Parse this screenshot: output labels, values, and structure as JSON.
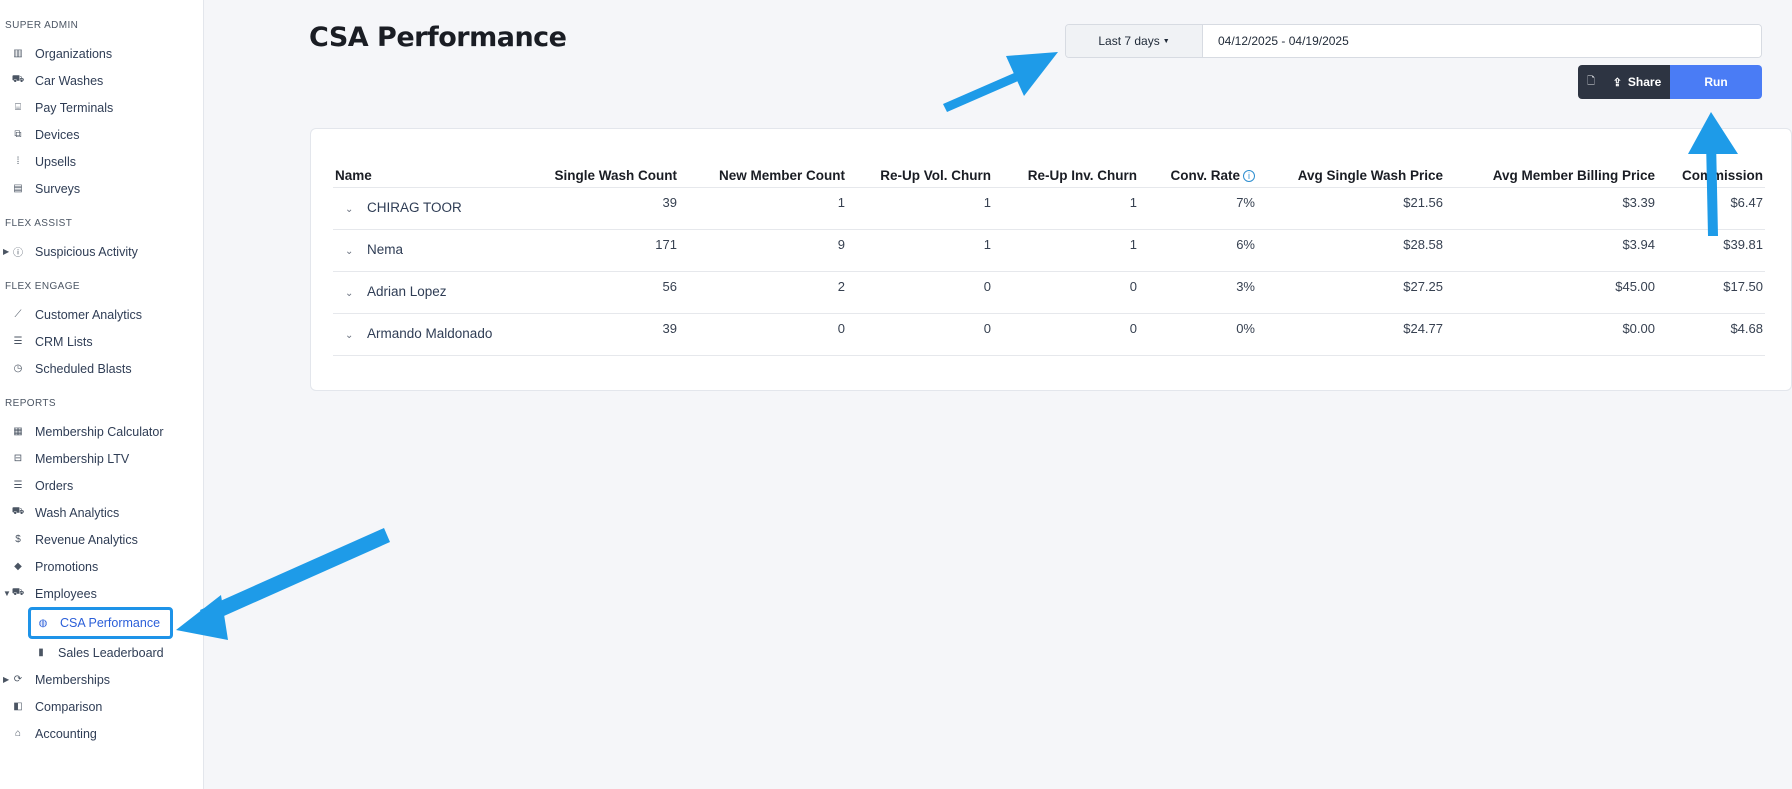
{
  "sidebar": {
    "sections": [
      {
        "title": "SUPER ADMIN",
        "items": [
          {
            "label": "Organizations",
            "icon": "building-icon"
          },
          {
            "label": "Car Washes",
            "icon": "car-icon"
          },
          {
            "label": "Pay Terminals",
            "icon": "terminal-icon"
          },
          {
            "label": "Devices",
            "icon": "device-icon"
          },
          {
            "label": "Upsells",
            "icon": "upsell-icon"
          },
          {
            "label": "Surveys",
            "icon": "clipboard-icon"
          }
        ]
      },
      {
        "title": "FLEX ASSIST",
        "items": [
          {
            "label": "Suspicious Activity",
            "icon": "alert-icon"
          }
        ]
      },
      {
        "title": "FLEX ENGAGE",
        "items": [
          {
            "label": "Customer Analytics",
            "icon": "line-chart-icon"
          },
          {
            "label": "CRM Lists",
            "icon": "list-icon"
          },
          {
            "label": "Scheduled Blasts",
            "icon": "clock-icon"
          }
        ]
      },
      {
        "title": "REPORTS",
        "items": [
          {
            "label": "Membership Calculator",
            "icon": "calculator-icon"
          },
          {
            "label": "Membership LTV",
            "icon": "ticket-icon"
          },
          {
            "label": "Orders",
            "icon": "orders-icon"
          },
          {
            "label": "Wash Analytics",
            "icon": "car-icon"
          },
          {
            "label": "Revenue Analytics",
            "icon": "dollar-icon"
          },
          {
            "label": "Promotions",
            "icon": "tag-icon"
          },
          {
            "label": "Employees",
            "icon": "employees-icon"
          },
          {
            "label": "CSA Performance",
            "icon": "gauge-icon"
          },
          {
            "label": "Sales Leaderboard",
            "icon": "bar-chart-icon"
          },
          {
            "label": "Memberships",
            "icon": "refresh-icon"
          },
          {
            "label": "Comparison",
            "icon": "compare-icon"
          },
          {
            "label": "Accounting",
            "icon": "bank-icon"
          }
        ]
      }
    ]
  },
  "page": {
    "title": "CSA Performance"
  },
  "filters": {
    "range_label": "Last 7 days",
    "date_value": "04/12/2025 - 04/19/2025"
  },
  "actions": {
    "share_label": "Share",
    "run_label": "Run"
  },
  "table": {
    "columns": [
      "Name",
      "Single Wash Count",
      "New Member Count",
      "Re-Up Vol. Churn",
      "Re-Up Inv. Churn",
      "Conv. Rate",
      "Avg Single Wash Price",
      "Avg Member Billing Price",
      "Commission"
    ],
    "rows": [
      [
        "CHIRAG TOOR",
        "39",
        "1",
        "1",
        "1",
        "7%",
        "$21.56",
        "$3.39",
        "$6.47"
      ],
      [
        "Nema",
        "171",
        "9",
        "1",
        "1",
        "6%",
        "$28.58",
        "$3.94",
        "$39.81"
      ],
      [
        "Adrian Lopez",
        "56",
        "2",
        "0",
        "0",
        "3%",
        "$27.25",
        "$45.00",
        "$17.50"
      ],
      [
        "Armando Maldonado",
        "39",
        "0",
        "0",
        "0",
        "0%",
        "$24.77",
        "$0.00",
        "$4.68"
      ]
    ]
  },
  "colors": {
    "accent": "#4a7cf5",
    "highlight": "#1e93e8",
    "dark_button": "#2d3442"
  }
}
